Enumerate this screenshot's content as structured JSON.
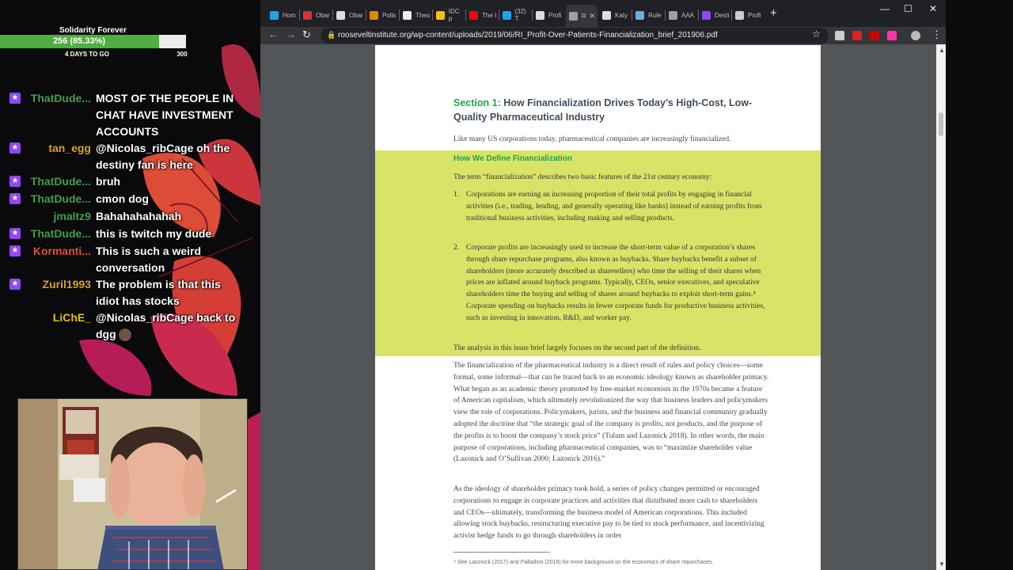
{
  "overlay": {
    "goal": {
      "title": "Solidarity Forever",
      "count": "256 (85.33%)",
      "progress": 0.8533,
      "days_left": "4 DAYS TO GO",
      "target": "300",
      "fill_color": "#4caf3f"
    },
    "chat": [
      {
        "user": "ThatDude...",
        "color": "#3fa34d",
        "badge": true,
        "message": "MOST OF THE PEOPLE IN CHAT HAVE INVESTMENT ACCOUNTS"
      },
      {
        "user": "tan_egg",
        "color": "#daa520",
        "badge": true,
        "message": "@Nicolas_ribCage oh the destiny fan is here"
      },
      {
        "user": "ThatDude...",
        "color": "#3fa34d",
        "badge": true,
        "message": "bruh"
      },
      {
        "user": "ThatDude...",
        "color": "#3fa34d",
        "badge": true,
        "message": "cmon dog"
      },
      {
        "user": "jmaltz9",
        "color": "#3fa34d",
        "badge": false,
        "message": "Bahahahahahah"
      },
      {
        "user": "ThatDude...",
        "color": "#3fa34d",
        "badge": true,
        "message": "this is twitch my dude"
      },
      {
        "user": "Kormanti...",
        "color": "#e0552a",
        "badge": true,
        "message": "This is such a weird conversation"
      },
      {
        "user": "Zuril1993",
        "color": "#daa520",
        "badge": true,
        "message": "The problem is that this idiot has stocks"
      },
      {
        "user": "LiChE_",
        "color": "#e6c300",
        "badge": false,
        "message": "@Nicolas_ribCage back to dgg"
      }
    ]
  },
  "browser": {
    "tabs": [
      {
        "label": "Hom",
        "icon": "twitter-icon",
        "color": "#1da1f2"
      },
      {
        "label": "Obar",
        "icon": "news-icon",
        "color": "#d33"
      },
      {
        "label": "Obar",
        "icon": "nyt-icon",
        "color": "#ddd"
      },
      {
        "label": "Polls",
        "icon": "polls-icon",
        "color": "#e08a00"
      },
      {
        "label": "Theo",
        "icon": "wikipedia-icon",
        "color": "#eee"
      },
      {
        "label": "IDC p",
        "icon": "lightbulb-icon",
        "color": "#f5c400"
      },
      {
        "label": "The I",
        "icon": "youtube-icon",
        "color": "#f00"
      },
      {
        "label": "(32) T",
        "icon": "twitter-icon",
        "color": "#1da1f2"
      },
      {
        "label": "Profi",
        "icon": "roosevelt-icon",
        "color": "#ddd"
      },
      {
        "label": "R",
        "icon": "globe-icon",
        "color": "#9aa0a6"
      },
      {
        "label": "Katy",
        "icon": "roosevelt-icon",
        "color": "#ddd"
      },
      {
        "label": "Rule",
        "icon": "bird-icon",
        "color": "#6ab0e0"
      },
      {
        "label": "AAA",
        "icon": "globe-icon",
        "color": "#9aa0a6"
      },
      {
        "label": "Desti",
        "icon": "twitch-icon",
        "color": "#9146ff"
      },
      {
        "label": "Profi",
        "icon": "gear-icon",
        "color": "#ccc"
      }
    ],
    "new_tab": "+",
    "url": "rooseveltinstitute.org/wp-content/uploads/2019/06/RI_Profit-Over-Patients-Financialization_brief_201906.pdf"
  },
  "document": {
    "section_label": "Section 1:",
    "section_title": "How Financialization Drives Today’s High-Cost, Low-Quality Pharmaceutical Industry",
    "intro": "Like many US corporations today, pharmaceutical companies are increasingly financialized.",
    "box_title": "How We Define Financialization",
    "box_intro": "The term “financialization” describes two basic features of the 21st century economy:",
    "list": [
      {
        "num": "1.",
        "text": "Corporations are earning an increasing proportion of their total profits by engaging in financial activities (i.e., trading, lending, and generally operating like banks) instead of earning profits from traditional business activities, including making and selling products."
      },
      {
        "num": "2.",
        "text": "Corporate profits are increasingly used to increase the short-term value of a corporation’s shares through share repurchase programs, also known as buybacks. Share buybacks benefit a subset of shareholders (more accurately described as sharesellers) who time the selling of their shares when prices are inflated around buyback programs. Typically, CEOs, senior executives, and speculative shareholders time the buying and selling of shares around buybacks to exploit short-term gains.⁴ Corporate spending on buybacks results in fewer corporate funds for productive business activities, such as investing in innovation, R&D, and worker pay."
      }
    ],
    "box_end": "The analysis in this issue brief largely focuses on the second part of the definition.",
    "para1": "The financialization of the pharmaceutical industry is a direct result of rules and policy choices—some formal, some informal—that can be traced back to an economic ideology known as shareholder primacy. What began as an academic theory promoted by free-market economists in the 1970s became a feature of American capitalism, which ultimately revolutionized the way that business leaders and policymakers view the role of corporations. Policymakers, jurists, and the business and financial community gradually adopted the doctrine that “the strategic goal of the company is profits, not products, and the purpose of the profits is to boost the company’s stock price” (Tulum and Lazonick 2018). In other words, the main purpose of corporations, including pharmaceutical companies, was to “maximize shareholder value (Lazonick and O’Sullivan 2000; Lazonick 2016).”",
    "para2": "As the ideology of shareholder primacy took hold, a series of policy changes permitted or encouraged corporations to engage in corporate practices and activities that distributed more cash to shareholders and CEOs—ultimately, transforming the business model of American corporations. This included allowing stock buybacks, restructuring executive pay to be tied to stock performance, and incentivizing activist hedge funds to go through shareholders in order",
    "footnote": "⁴ See Lazonick (2017) and Palladino (2018) for more background on the economics of share repurchases."
  }
}
